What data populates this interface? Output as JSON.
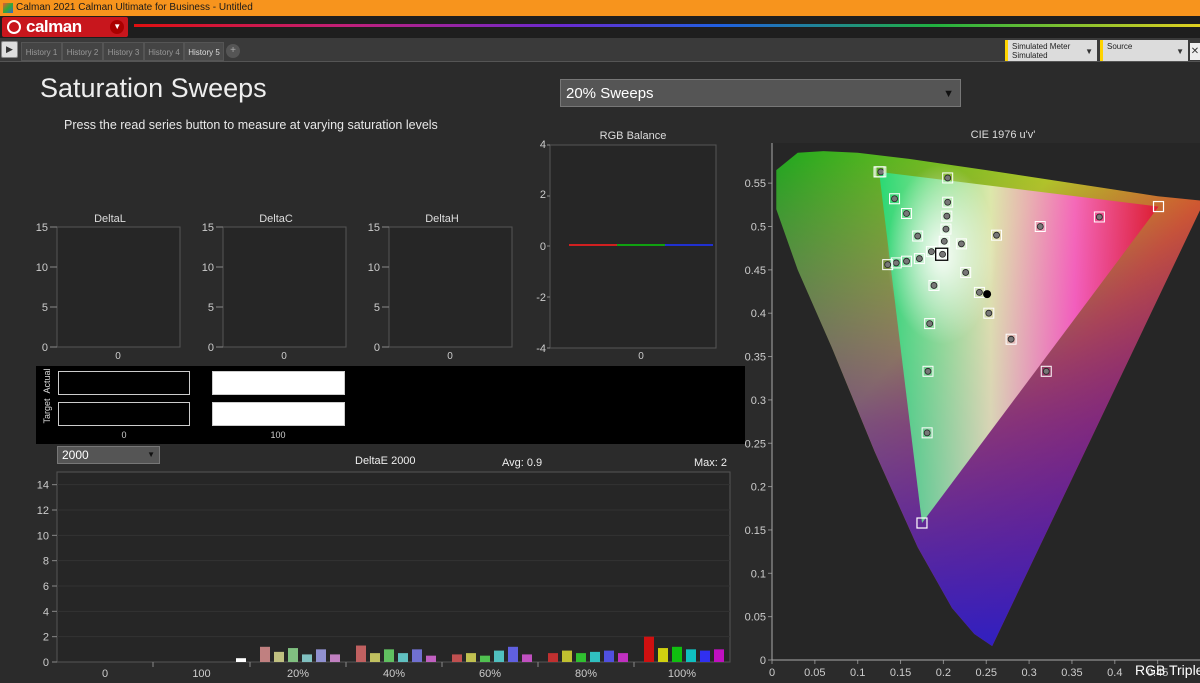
{
  "window": {
    "title": "Calman 2021 Calman Ultimate for Business - Untitled"
  },
  "logo": {
    "text": "calman"
  },
  "history_tabs": [
    "History 1",
    "History 2",
    "History 3",
    "History 4",
    "History 5"
  ],
  "active_history_tab": "History 5",
  "meter": {
    "label": "Simulated Meter",
    "value": "Simulated"
  },
  "source": {
    "label": "Source"
  },
  "page": {
    "title": "Saturation Sweeps",
    "instruction": "Press the read series button to measure at varying saturation levels",
    "sweep_select": "20% Sweeps"
  },
  "small_charts": [
    {
      "title": "DeltaL",
      "y_ticks": [
        "15",
        "10",
        "5",
        "0"
      ],
      "x_label": "0"
    },
    {
      "title": "DeltaC",
      "y_ticks": [
        "15",
        "10",
        "5",
        "0"
      ],
      "x_label": "0"
    },
    {
      "title": "DeltaH",
      "y_ticks": [
        "15",
        "10",
        "5",
        "0"
      ],
      "x_label": "0"
    }
  ],
  "rgb_balance": {
    "title": "RGB Balance",
    "y_ticks": [
      "4",
      "2",
      "0",
      "-2",
      "-4"
    ],
    "x_label": "0",
    "values": {
      "red": 0.05,
      "green": 0,
      "blue": 0.05
    },
    "colors": {
      "red": "#d02020",
      "green": "#10a010",
      "blue": "#2030d0"
    }
  },
  "swatches": {
    "actual_label": "Actual",
    "target_label": "Target",
    "items": [
      {
        "label": "0",
        "actual": "#000000",
        "target": "#000000"
      },
      {
        "label": "100",
        "actual": "#ffffff",
        "target": "#ffffff"
      }
    ]
  },
  "deltae": {
    "select_value": "2000",
    "title": "DeltaE 2000",
    "avg": "Avg: 0.9",
    "max": "Max: 2",
    "y_ticks": [
      "14",
      "12",
      "10",
      "8",
      "6",
      "4",
      "2",
      "0"
    ],
    "groups": [
      "0",
      "100",
      "20%",
      "40%",
      "60%",
      "80%",
      "100%"
    ]
  },
  "cie": {
    "title": "CIE 1976 u'v'",
    "x_ticks": [
      "0",
      "0.05",
      "0.1",
      "0.15",
      "0.2",
      "0.25",
      "0.3",
      "0.35",
      "0.4",
      "0.45"
    ],
    "y_ticks": [
      "0.55",
      "0.5",
      "0.45",
      "0.4",
      "0.35",
      "0.3",
      "0.25",
      "0.2",
      "0.15",
      "0.1",
      "0.05",
      "0"
    ],
    "footer": "RGB Triple"
  },
  "chart_data": [
    {
      "type": "bar",
      "title": "DeltaE 2000",
      "categories": [
        "0",
        "100",
        "20% R",
        "20% Y",
        "20% G",
        "20% C",
        "20% B",
        "20% M",
        "40% R",
        "40% Y",
        "40% G",
        "40% C",
        "40% B",
        "40% M",
        "60% R",
        "60% Y",
        "60% G",
        "60% C",
        "60% B",
        "60% M",
        "80% R",
        "80% Y",
        "80% G",
        "80% C",
        "80% B",
        "80% M",
        "100% R",
        "100% Y",
        "100% G",
        "100% C",
        "100% B",
        "100% M"
      ],
      "values": [
        0.0,
        0.3,
        1.2,
        0.8,
        1.1,
        0.6,
        1.0,
        0.6,
        1.3,
        0.7,
        1.0,
        0.7,
        1.0,
        0.5,
        0.6,
        0.7,
        0.5,
        0.9,
        1.2,
        0.6,
        0.7,
        0.9,
        0.7,
        0.8,
        0.9,
        0.7,
        2.0,
        1.1,
        1.2,
        1.0,
        0.9,
        1.0
      ],
      "colors": [
        "#888888",
        "#ffffff",
        "#c08080",
        "#c0c080",
        "#80c080",
        "#80c0c0",
        "#9090d0",
        "#c080c0",
        "#c06060",
        "#c0c060",
        "#60c060",
        "#60c0c0",
        "#7070d0",
        "#c060c0",
        "#c05050",
        "#c0c050",
        "#50c050",
        "#50c0c0",
        "#6060e0",
        "#c050c0",
        "#c03030",
        "#c0c030",
        "#30c030",
        "#30c0c0",
        "#5050e0",
        "#c030c0",
        "#d01010",
        "#d0d010",
        "#10c010",
        "#10c0c0",
        "#3030f0",
        "#c010c0"
      ],
      "ylim": [
        0,
        15
      ]
    },
    {
      "type": "scatter",
      "title": "CIE 1976 u'v'",
      "gamut_triangle": [
        [
          0.451,
          0.523
        ],
        [
          0.125,
          0.563
        ],
        [
          0.175,
          0.158
        ]
      ],
      "white_point": [
        0.198,
        0.468
      ],
      "measured_targets": [
        [
          0.199,
          0.468
        ],
        [
          0.221,
          0.48
        ],
        [
          0.262,
          0.49
        ],
        [
          0.313,
          0.5
        ],
        [
          0.382,
          0.511
        ],
        [
          0.201,
          0.483
        ],
        [
          0.203,
          0.497
        ],
        [
          0.204,
          0.512
        ],
        [
          0.205,
          0.528
        ],
        [
          0.205,
          0.556
        ],
        [
          0.186,
          0.471
        ],
        [
          0.17,
          0.489
        ],
        [
          0.157,
          0.515
        ],
        [
          0.143,
          0.532
        ],
        [
          0.127,
          0.563
        ],
        [
          0.172,
          0.463
        ],
        [
          0.157,
          0.46
        ],
        [
          0.145,
          0.458
        ],
        [
          0.135,
          0.456
        ],
        [
          0.189,
          0.432
        ],
        [
          0.184,
          0.388
        ],
        [
          0.182,
          0.333
        ],
        [
          0.181,
          0.262
        ],
        [
          0.226,
          0.447
        ],
        [
          0.242,
          0.424
        ],
        [
          0.253,
          0.4
        ],
        [
          0.279,
          0.37
        ],
        [
          0.32,
          0.333
        ]
      ],
      "current_point": [
        0.251,
        0.422
      ]
    }
  ]
}
